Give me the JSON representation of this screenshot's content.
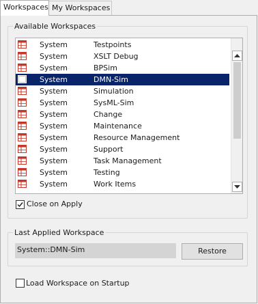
{
  "tabs": [
    {
      "label": "Workspaces",
      "active": true
    },
    {
      "label": "My Workspaces",
      "active": false
    }
  ],
  "available": {
    "group_label": "Available Workspaces",
    "rows": [
      {
        "type": "System",
        "name": "Testpoints",
        "selected": false
      },
      {
        "type": "System",
        "name": "XSLT Debug",
        "selected": false
      },
      {
        "type": "System",
        "name": "BPSim",
        "selected": false
      },
      {
        "type": "System",
        "name": "DMN-Sim",
        "selected": true
      },
      {
        "type": "System",
        "name": "Simulation",
        "selected": false
      },
      {
        "type": "System",
        "name": "SysML-Sim",
        "selected": false
      },
      {
        "type": "System",
        "name": "Change",
        "selected": false
      },
      {
        "type": "System",
        "name": "Maintenance",
        "selected": false
      },
      {
        "type": "System",
        "name": "Resource Management",
        "selected": false
      },
      {
        "type": "System",
        "name": "Support",
        "selected": false
      },
      {
        "type": "System",
        "name": "Task Management",
        "selected": false
      },
      {
        "type": "System",
        "name": "Testing",
        "selected": false
      },
      {
        "type": "System",
        "name": "Work Items",
        "selected": false
      }
    ],
    "row_icon": "workspace-layout-icon",
    "close_on_apply": {
      "label": "Close on Apply",
      "checked": true
    }
  },
  "last_applied": {
    "group_label": "Last Applied Workspace",
    "value": "System::DMN-Sim",
    "restore_label": "Restore"
  },
  "load_on_startup": {
    "label": "Load Workspace on Startup",
    "checked": false
  },
  "colors": {
    "selection": "#0a246a",
    "icon_red": "#c0392b"
  }
}
